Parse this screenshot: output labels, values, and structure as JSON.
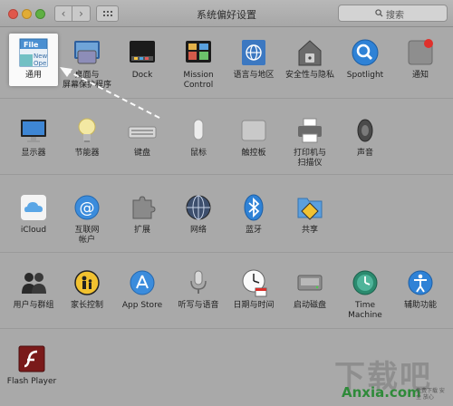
{
  "window": {
    "title": "系统偏好设置"
  },
  "toolbar": {
    "back": "‹",
    "forward": "›"
  },
  "search": {
    "placeholder": "搜索"
  },
  "rows": [
    {
      "items": [
        {
          "label": "通用",
          "icon": "general-icon"
        },
        {
          "label": "桌面与\n屏幕保护程序",
          "icon": "desktop-icon"
        },
        {
          "label": "Dock",
          "icon": "dock-icon"
        },
        {
          "label": "Mission\nControl",
          "icon": "mission-control-icon"
        },
        {
          "label": "语言与地区",
          "icon": "language-region-icon"
        },
        {
          "label": "安全性与隐私",
          "icon": "security-icon"
        },
        {
          "label": "Spotlight",
          "icon": "spotlight-icon"
        },
        {
          "label": "通知",
          "icon": "notifications-icon"
        }
      ]
    },
    {
      "items": [
        {
          "label": "显示器",
          "icon": "displays-icon"
        },
        {
          "label": "节能器",
          "icon": "energy-saver-icon"
        },
        {
          "label": "键盘",
          "icon": "keyboard-icon"
        },
        {
          "label": "鼠标",
          "icon": "mouse-icon"
        },
        {
          "label": "触控板",
          "icon": "trackpad-icon"
        },
        {
          "label": "打印机与\n扫描仪",
          "icon": "printer-icon"
        },
        {
          "label": "声音",
          "icon": "sound-icon"
        }
      ]
    },
    {
      "items": [
        {
          "label": "iCloud",
          "icon": "icloud-icon"
        },
        {
          "label": "互联网\n帐户",
          "icon": "internet-accounts-icon"
        },
        {
          "label": "扩展",
          "icon": "extensions-icon"
        },
        {
          "label": "网络",
          "icon": "network-icon"
        },
        {
          "label": "蓝牙",
          "icon": "bluetooth-icon"
        },
        {
          "label": "共享",
          "icon": "sharing-icon"
        }
      ]
    },
    {
      "items": [
        {
          "label": "用户与群组",
          "icon": "users-groups-icon"
        },
        {
          "label": "家长控制",
          "icon": "parental-controls-icon"
        },
        {
          "label": "App Store",
          "icon": "app-store-icon"
        },
        {
          "label": "听写与语音",
          "icon": "dictation-icon"
        },
        {
          "label": "日期与时间",
          "icon": "date-time-icon"
        },
        {
          "label": "启动磁盘",
          "icon": "startup-disk-icon"
        },
        {
          "label": "Time Machine",
          "icon": "time-machine-icon"
        },
        {
          "label": "辅助功能",
          "icon": "accessibility-icon"
        }
      ]
    },
    {
      "items": [
        {
          "label": "Flash Player",
          "icon": "flash-player-icon"
        }
      ]
    }
  ],
  "general_icon_text": {
    "line1": "File",
    "line2": "New",
    "line3": "Ope"
  },
  "watermark": {
    "big": "下载吧",
    "small": "Anxia.com",
    "tiny": "免费下载 安全 放心"
  },
  "colors": {
    "accent": "#3b8cdc",
    "window_bg": "#a9a9a9",
    "badge": "#e0302b"
  }
}
